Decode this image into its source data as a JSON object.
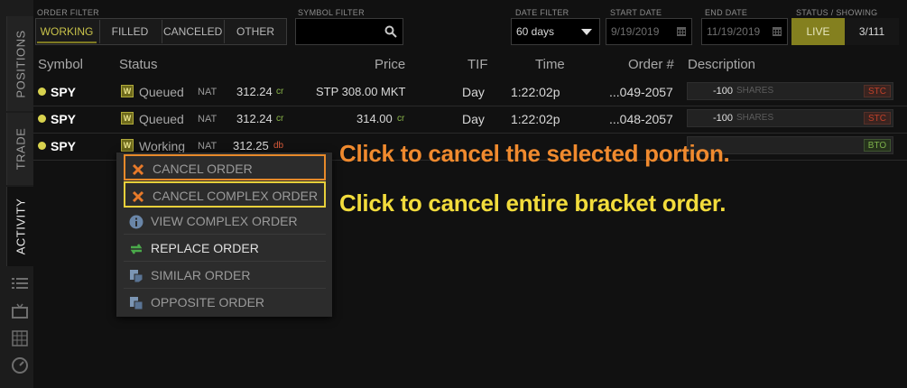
{
  "sidebar": {
    "tabs": [
      {
        "label": "POSITIONS"
      },
      {
        "label": "TRADE"
      },
      {
        "label": "ACTIVITY"
      }
    ],
    "icons": [
      "list-icon",
      "tv-icon",
      "grid-icon",
      "gauge-icon"
    ]
  },
  "filters": {
    "order_filter_label": "ORDER FILTER",
    "order_filter_buttons": [
      "WORKING",
      "FILLED",
      "CANCELED",
      "OTHER"
    ],
    "symbol_filter_label": "SYMBOL FILTER",
    "symbol_filter_value": "",
    "date_filter_label": "DATE FILTER",
    "date_filter_value": "60 days",
    "start_date_label": "START DATE",
    "start_date_value": "9/19/2019",
    "end_date_label": "END DATE",
    "end_date_value": "11/19/2019",
    "status_label": "STATUS / SHOWING",
    "status_live": "LIVE",
    "showing": "3/111"
  },
  "table": {
    "headers": [
      "Symbol",
      "Status",
      "Price",
      "TIF",
      "Time",
      "Order #",
      "Description"
    ],
    "rows": [
      {
        "symbol": "SPY",
        "status": "Queued",
        "nat": "NAT",
        "mark": "312.24",
        "mark_sub": "cr",
        "price": "STP 308.00 MKT",
        "price_sub": "",
        "tif": "Day",
        "time": "1:22:02p",
        "order": "...049-2057",
        "qty": "-100",
        "shares": "SHARES",
        "tag": "STC"
      },
      {
        "symbol": "SPY",
        "status": "Queued",
        "nat": "NAT",
        "mark": "312.24",
        "mark_sub": "cr",
        "price": "314.00",
        "price_sub": "cr",
        "tif": "Day",
        "time": "1:22:02p",
        "order": "...048-2057",
        "qty": "-100",
        "shares": "SHARES",
        "tag": "STC"
      },
      {
        "symbol": "SPY",
        "status": "Working",
        "nat": "NAT",
        "mark": "312.25",
        "mark_sub": "db",
        "price": "",
        "price_sub": "",
        "tif": "",
        "time": "",
        "order": "",
        "qty": "",
        "shares": "",
        "tag": "BTO"
      }
    ]
  },
  "context_menu": {
    "items": [
      {
        "label": "CANCEL ORDER",
        "icon": "x-icon"
      },
      {
        "label": "CANCEL COMPLEX ORDER",
        "icon": "x-icon"
      },
      {
        "label": "VIEW COMPLEX ORDER",
        "icon": "info-icon"
      },
      {
        "label": "REPLACE ORDER",
        "icon": "replace-arrows-icon"
      },
      {
        "label": "SIMILAR ORDER",
        "icon": "similar-order-icon"
      },
      {
        "label": "OPPOSITE ORDER",
        "icon": "opposite-order-icon"
      }
    ]
  },
  "annotations": {
    "cancel_selected": "Click to cancel the selected portion.",
    "cancel_bracket": "Click to cancel entire bracket order."
  },
  "colors": {
    "accent_yellow": "#c8c24a",
    "live_bg": "#84801f",
    "highlight_orange": "#e88a2a",
    "highlight_yellow": "#e8d03a",
    "credit_green": "#8cb84a",
    "debit_red": "#d85a3a"
  }
}
